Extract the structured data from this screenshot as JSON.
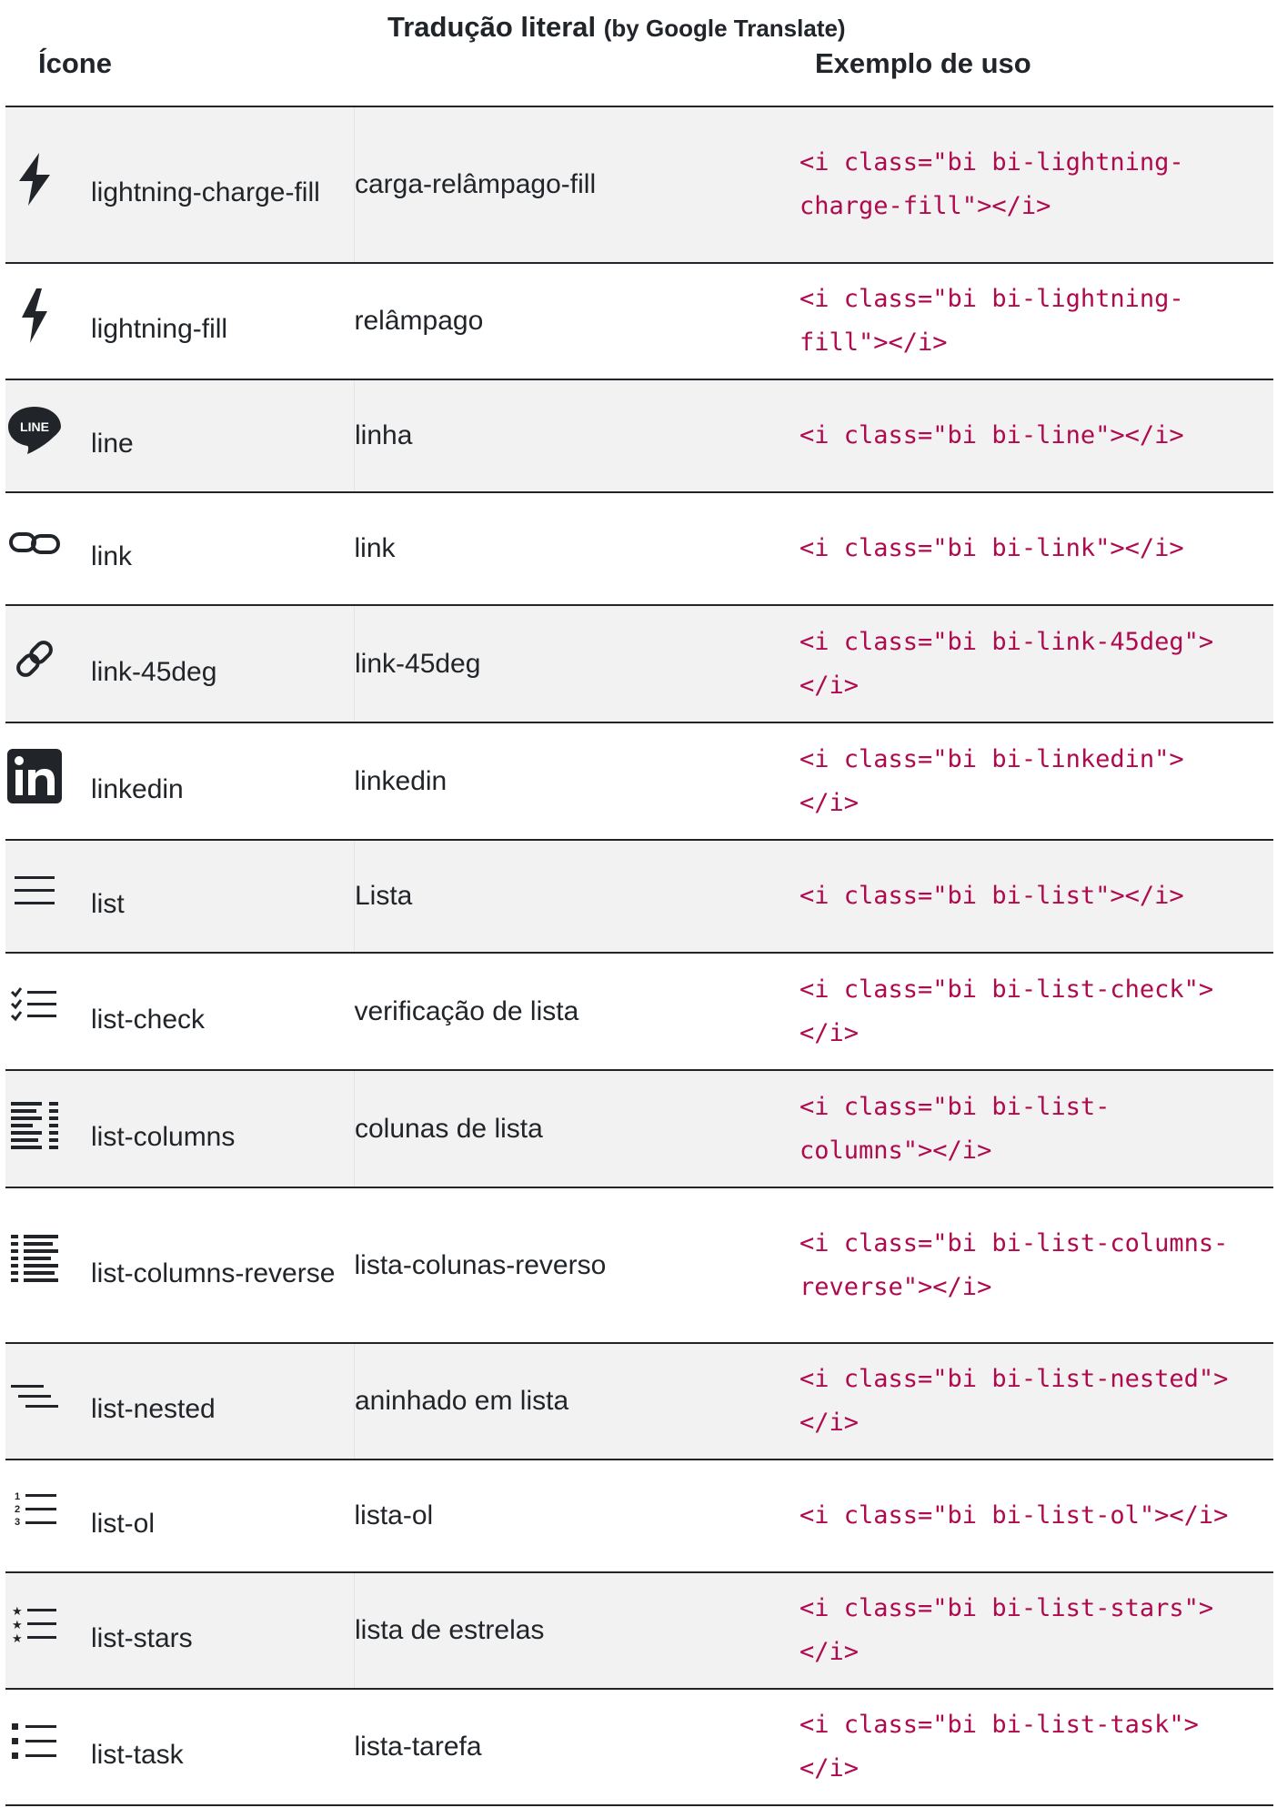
{
  "headers": {
    "icon": "Ícone",
    "translation_main": "Tradução literal",
    "translation_small": "(by Google Translate)",
    "example": "Exemplo de uso"
  },
  "rows": [
    {
      "icon": "lightning-charge-fill-icon",
      "name": "lightning-charge-fill",
      "translation": "carga-relâmpago-fill",
      "code": "<i class=\"bi bi-lightning-charge-fill\"></i>",
      "code_display": "<i class=\"bi bi-lightning-\ncharge-fill\"></i>"
    },
    {
      "icon": "lightning-fill-icon",
      "name": "lightning-fill",
      "translation": "relâmpago",
      "code": "<i class=\"bi bi-lightning-fill\"></i>",
      "code_display": "<i class=\"bi bi-lightning-\nfill\"></i>"
    },
    {
      "icon": "line-icon",
      "name": "line",
      "translation": "linha",
      "code": "<i class=\"bi bi-line\"></i>",
      "code_display": "<i class=\"bi bi-line\"></i>"
    },
    {
      "icon": "link-icon",
      "name": "link",
      "translation": "link",
      "code": "<i class=\"bi bi-link\"></i>",
      "code_display": "<i class=\"bi bi-link\"></i>"
    },
    {
      "icon": "link-45deg-icon",
      "name": "link-45deg",
      "translation": "link-45deg",
      "code": "<i class=\"bi bi-link-45deg\"></i>",
      "code_display": "<i class=\"bi bi-link-45deg\">\n</i>"
    },
    {
      "icon": "linkedin-icon",
      "name": "linkedin",
      "translation": "linkedin",
      "code": "<i class=\"bi bi-linkedin\"></i>",
      "code_display": "<i class=\"bi bi-linkedin\">\n</i>"
    },
    {
      "icon": "list-icon",
      "name": "list",
      "translation": "Lista",
      "code": "<i class=\"bi bi-list\"></i>",
      "code_display": "<i class=\"bi bi-list\"></i>"
    },
    {
      "icon": "list-check-icon",
      "name": "list-check",
      "translation": "verificação de lista",
      "code": "<i class=\"bi bi-list-check\"></i>",
      "code_display": "<i class=\"bi bi-list-check\">\n</i>"
    },
    {
      "icon": "list-columns-icon",
      "name": "list-columns",
      "translation": "colunas de lista",
      "code": "<i class=\"bi bi-list-columns\"></i>",
      "code_display": "<i class=\"bi bi-list-\ncolumns\"></i>"
    },
    {
      "icon": "list-columns-reverse-icon",
      "name": "list-columns-reverse",
      "translation": "lista-colunas-reverso",
      "code": "<i class=\"bi bi-list-columns-reverse\"></i>",
      "code_display": "<i class=\"bi bi-list-columns-\nreverse\"></i>"
    },
    {
      "icon": "list-nested-icon",
      "name": "list-nested",
      "translation": "aninhado em lista",
      "code": "<i class=\"bi bi-list-nested\"></i>",
      "code_display": "<i class=\"bi bi-list-nested\">\n</i>"
    },
    {
      "icon": "list-ol-icon",
      "name": "list-ol",
      "translation": "lista-ol",
      "code": "<i class=\"bi bi-list-ol\"></i>",
      "code_display": "<i class=\"bi bi-list-ol\"></i>"
    },
    {
      "icon": "list-stars-icon",
      "name": "list-stars",
      "translation": "lista de estrelas",
      "code": "<i class=\"bi bi-list-stars\"></i>",
      "code_display": "<i class=\"bi bi-list-stars\">\n</i>"
    },
    {
      "icon": "list-task-icon",
      "name": "list-task",
      "translation": "lista-tarefa",
      "code": "<i class=\"bi bi-list-task\"></i>",
      "code_display": "<i class=\"bi bi-list-task\">\n</i>"
    }
  ]
}
